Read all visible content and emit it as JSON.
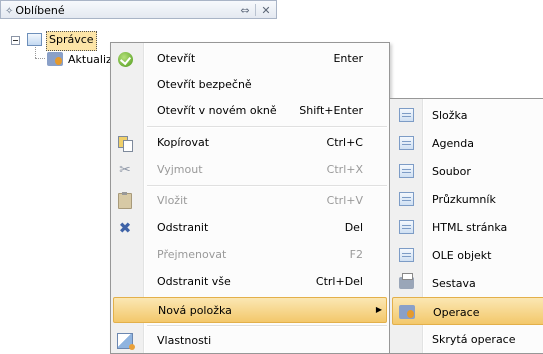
{
  "favorites": {
    "title": "Oblíbené",
    "tree": {
      "selected_label": "Správce",
      "child_label": "Aktualiza"
    }
  },
  "menu": {
    "items": [
      {
        "label": "Otevřít",
        "shortcut": "Enter",
        "icon": "check-icon",
        "disabled": false
      },
      {
        "label": "Otevřít bezpečně",
        "shortcut": "",
        "icon": "",
        "disabled": false
      },
      {
        "label": "Otevřít v novém okně",
        "shortcut": "Shift+Enter",
        "icon": "",
        "disabled": false
      },
      {
        "label": "Kopírovat",
        "shortcut": "Ctrl+C",
        "icon": "copy-icon",
        "disabled": false
      },
      {
        "label": "Vyjmout",
        "shortcut": "Ctrl+X",
        "icon": "cut-icon",
        "disabled": true
      },
      {
        "label": "Vložit",
        "shortcut": "Ctrl+V",
        "icon": "paste-icon",
        "disabled": true
      },
      {
        "label": "Odstranit",
        "shortcut": "Del",
        "icon": "delete-icon",
        "disabled": false
      },
      {
        "label": "Přejmenovat",
        "shortcut": "F2",
        "icon": "",
        "disabled": true
      },
      {
        "label": "Odstranit vše",
        "shortcut": "Ctrl+Del",
        "icon": "",
        "disabled": false
      },
      {
        "label": "Nová položka",
        "shortcut": "",
        "icon": "",
        "disabled": false,
        "highlighted": true,
        "has_submenu": true
      },
      {
        "label": "Vlastnosti",
        "shortcut": "",
        "icon": "properties-icon",
        "disabled": false
      }
    ]
  },
  "submenu": {
    "items": [
      {
        "label": "Složka",
        "icon": "folder-doc-icon"
      },
      {
        "label": "Agenda",
        "icon": "agenda-icon"
      },
      {
        "label": "Soubor",
        "icon": "file-icon"
      },
      {
        "label": "Průzkumník",
        "icon": "explorer-icon"
      },
      {
        "label": "HTML stránka",
        "icon": "html-page-icon"
      },
      {
        "label": "OLE objekt",
        "icon": "ole-object-icon"
      },
      {
        "label": "Sestava",
        "icon": "report-icon"
      },
      {
        "label": "Operace",
        "icon": "operation-icon",
        "highlighted": true
      },
      {
        "label": "Skrytá operace",
        "icon": ""
      }
    ]
  },
  "colors": {
    "highlight_top": "#fbe7b3",
    "highlight_bottom": "#f3c86b",
    "selection_bg": "#fde5a8",
    "disabled_text": "#9a9a9a"
  }
}
